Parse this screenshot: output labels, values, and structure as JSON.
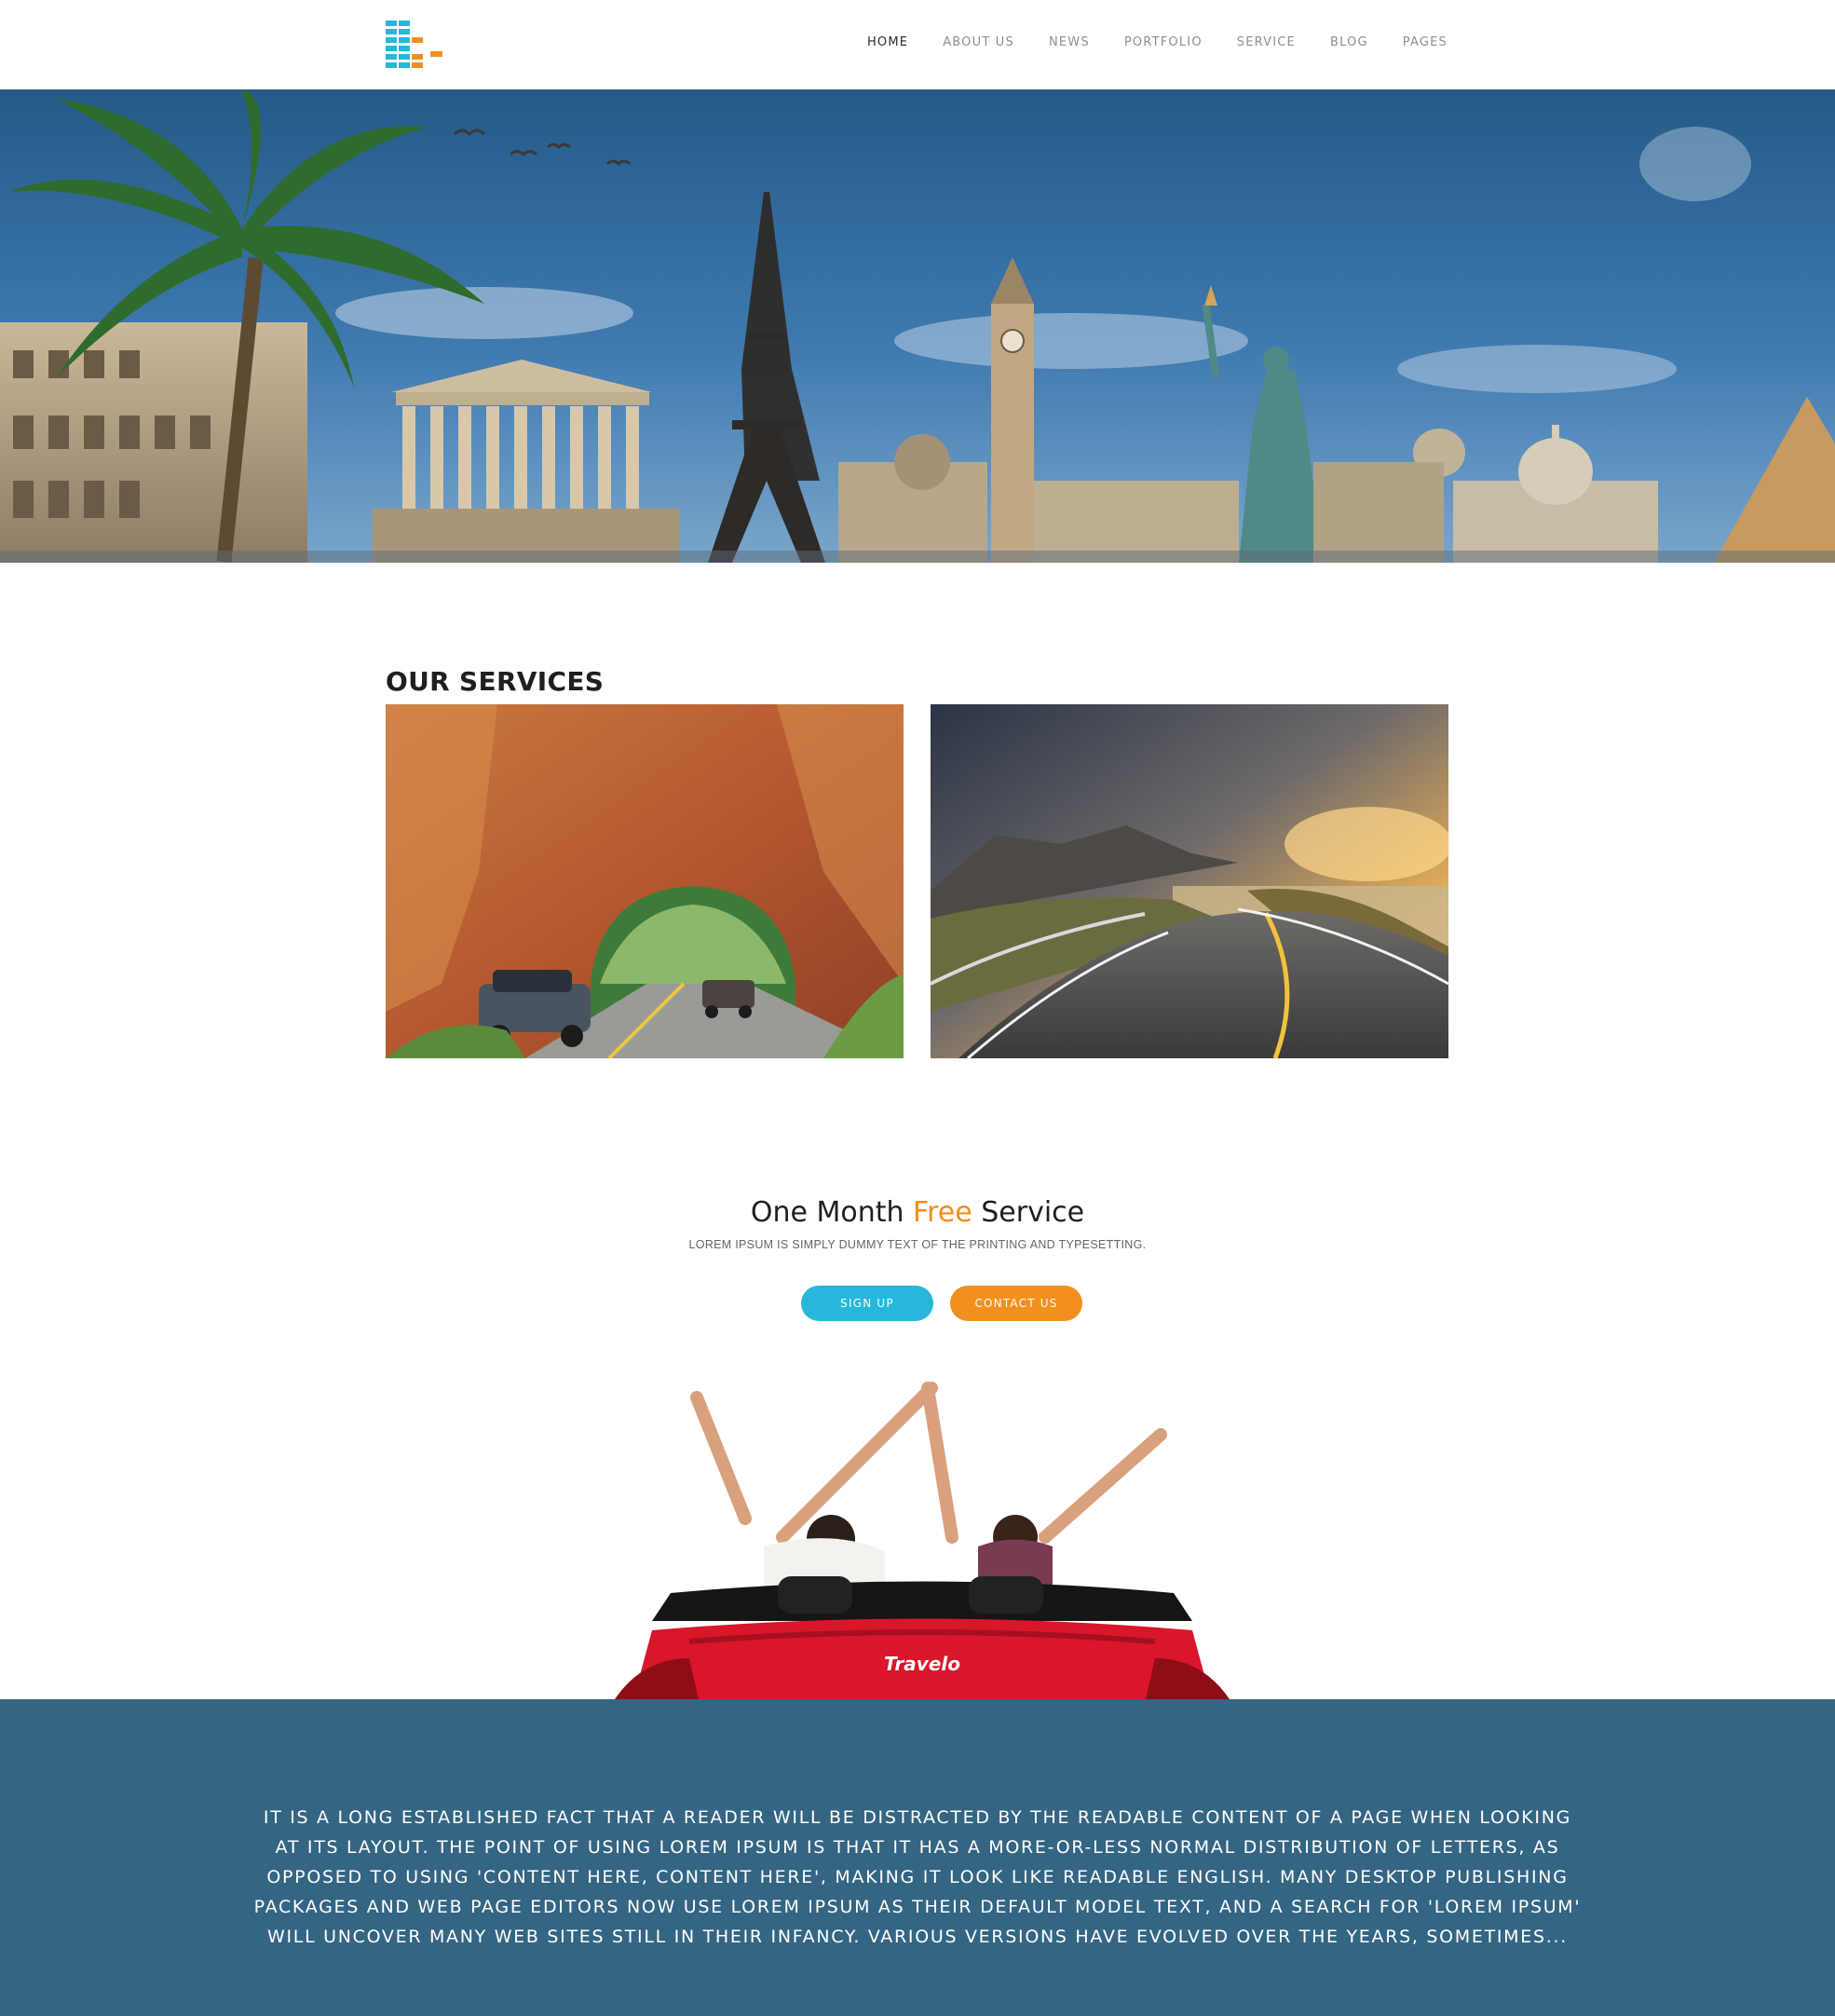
{
  "header": {
    "logo_name": "logo-mark",
    "nav": [
      {
        "label": "HOME",
        "active": true
      },
      {
        "label": "ABOUT US",
        "active": false
      },
      {
        "label": "NEWS",
        "active": false
      },
      {
        "label": "PORTFOLIO",
        "active": false
      },
      {
        "label": "SERVICE",
        "active": false
      },
      {
        "label": "BLOG",
        "active": false
      },
      {
        "label": "PAGES",
        "active": false
      }
    ]
  },
  "services": {
    "title": "OUR SERVICES"
  },
  "promo": {
    "title_before": "One Month ",
    "title_accent": "Free",
    "title_after": " Service",
    "subtitle": "LOREM IPSUM IS SIMPLY DUMMY TEXT OF THE PRINTING AND TYPESETTING.",
    "signup_label": "SIGN UP",
    "contact_label": "CONTACT US",
    "car_brand": "Travelo"
  },
  "about": {
    "text": "IT IS A LONG ESTABLISHED FACT THAT A READER WILL BE DISTRACTED BY THE READABLE CONTENT OF A PAGE WHEN LOOKING AT ITS LAYOUT. THE POINT OF USING LOREM IPSUM IS THAT IT HAS A MORE-OR-LESS NORMAL DISTRIBUTION OF LETTERS, AS OPPOSED TO USING 'CONTENT HERE, CONTENT HERE', MAKING IT LOOK LIKE READABLE ENGLISH. MANY DESKTOP PUBLISHING PACKAGES AND WEB PAGE EDITORS NOW USE LOREM IPSUM AS THEIR DEFAULT MODEL TEXT, AND A SEARCH FOR 'LOREM IPSUM' WILL UNCOVER MANY WEB SITES STILL IN THEIR INFANCY. VARIOUS VERSIONS HAVE EVOLVED OVER THE YEARS, SOMETIMES..."
  },
  "colors": {
    "accent_blue": "#27b7da",
    "accent_orange": "#f28c1c",
    "band_blue": "#346583"
  }
}
